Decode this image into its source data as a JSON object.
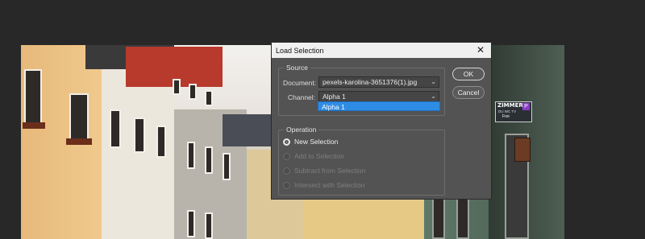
{
  "dialog": {
    "title": "Load Selection",
    "close_icon": "close-x-icon",
    "source": {
      "group_label": "Source",
      "document_label": "Document:",
      "document_value": "pexels-karolina-3651376(1).jpg",
      "channel_label": "Channel:",
      "channel_value": "Alpha 1",
      "channel_options": [
        "Alpha 1"
      ]
    },
    "operation": {
      "group_label": "Operation",
      "options": [
        {
          "label": "New Selection",
          "selected": true,
          "enabled": true
        },
        {
          "label": "Add to Selection",
          "selected": false,
          "enabled": false
        },
        {
          "label": "Subtract from Selection",
          "selected": false,
          "enabled": false
        },
        {
          "label": "Intersect with Selection",
          "selected": false,
          "enabled": false
        }
      ]
    },
    "ok_label": "OK",
    "cancel_label": "Cancel"
  },
  "canvas": {
    "sign_text": "ZIMMER",
    "sign_sub": "DU WC TV",
    "sign_frei": "Frei",
    "sign_p": "P"
  },
  "colors": {
    "app_background": "#282828",
    "dialog_background": "#535353",
    "selection_highlight": "#2f8ce5"
  }
}
